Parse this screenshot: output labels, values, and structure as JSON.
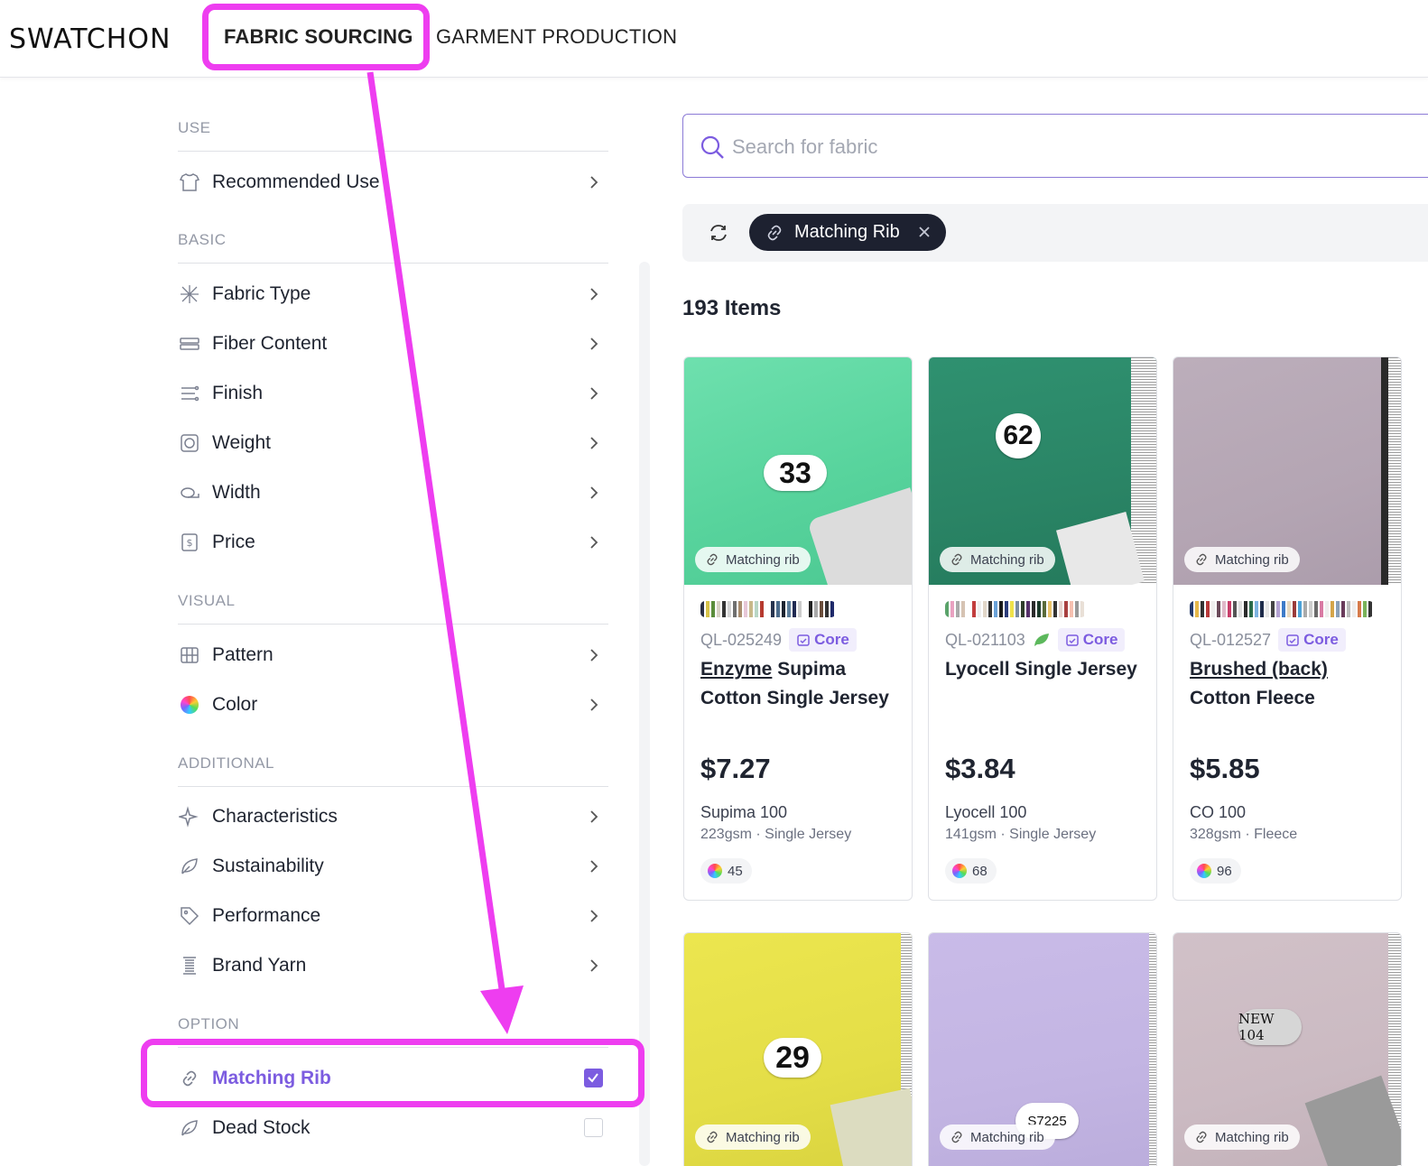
{
  "header": {
    "logo": "SWATCHON",
    "nav": {
      "fabric": "FABRIC SOURCING",
      "garment": "GARMENT PRODUCTION"
    }
  },
  "sidebar": {
    "sections": {
      "use": "USE",
      "basic": "BASIC",
      "visual": "VISUAL",
      "additional": "ADDITIONAL",
      "option": "OPTION"
    },
    "items": {
      "recommended_use": "Recommended Use",
      "fabric_type": "Fabric Type",
      "fiber_content": "Fiber Content",
      "finish": "Finish",
      "weight": "Weight",
      "width": "Width",
      "price": "Price",
      "pattern": "Pattern",
      "color": "Color",
      "characteristics": "Characteristics",
      "sustainability": "Sustainability",
      "performance": "Performance",
      "brand_yarn": "Brand Yarn",
      "matching_rib": "Matching Rib",
      "dead_stock": "Dead Stock"
    }
  },
  "search": {
    "placeholder": "Search for fabric"
  },
  "active_filter": {
    "label": "Matching Rib"
  },
  "results": {
    "count": "193 Items"
  },
  "cards": [
    {
      "badge": "Matching rib",
      "code": "QL-025249",
      "tag": "Core",
      "name_u": "Enzyme",
      "name_rest": " Supima Cotton Single Jersey",
      "price": "$7.27",
      "fiber": "Supima 100",
      "spec": "223gsm · Single Jersey",
      "colors": "45",
      "label_number": "33",
      "base_color": "#5fd6a2"
    },
    {
      "badge": "Matching rib",
      "code": "QL-021103",
      "tag": "Core",
      "name_u": "",
      "name_rest": "Lyocell Single Jersey",
      "price": "$3.84",
      "fiber": "Lyocell 100",
      "spec": "141gsm · Single Jersey",
      "colors": "68",
      "label_number": "62",
      "base_color": "#2f8f6e"
    },
    {
      "badge": "Matching rib",
      "code": "QL-012527",
      "tag": "Core",
      "name_u": "Brushed (back)",
      "name_rest": " Cotton Fleece",
      "price": "$5.85",
      "fiber": "CO 100",
      "spec": "328gsm · Fleece",
      "colors": "96",
      "base_color": "#b9aab8"
    },
    {
      "badge": "Matching rib",
      "label_number": "29",
      "base_color": "#e9e34f"
    },
    {
      "badge": "Matching rib",
      "label_number": "S7225",
      "base_color": "#c6b8e6"
    },
    {
      "badge": "Matching rib",
      "label_number": "NEW 104",
      "base_color": "#cdbcc4"
    }
  ],
  "colors": {
    "accent": "#7c5ce0",
    "annotation": "#ee3df0",
    "chip_bg": "#1d2130"
  }
}
